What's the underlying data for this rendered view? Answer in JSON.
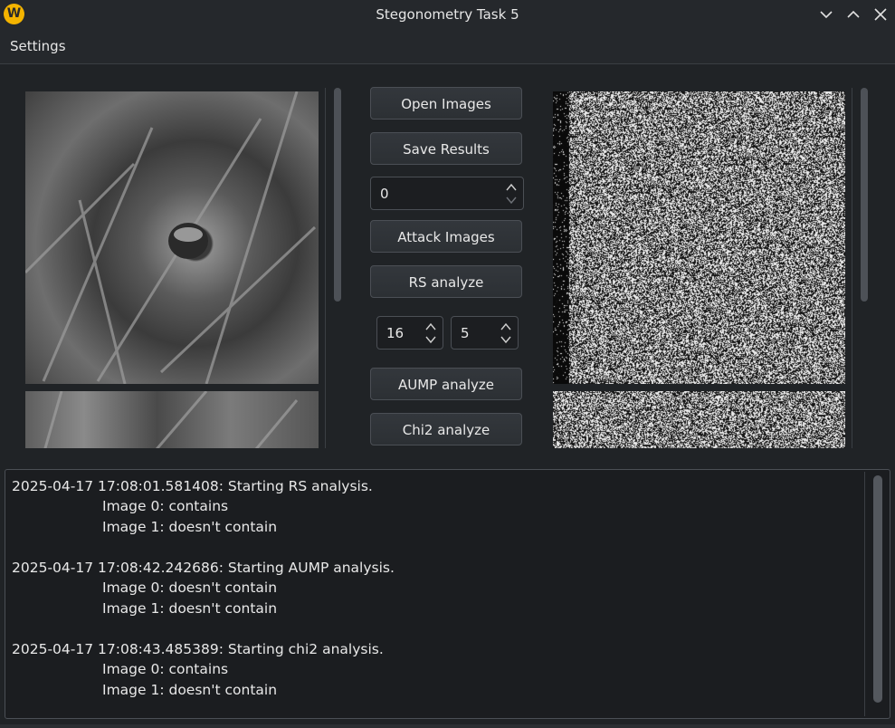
{
  "window": {
    "title": "Stegonometry Task 5",
    "logo_letter": "W"
  },
  "menu": {
    "items": [
      {
        "label": "Settings"
      }
    ]
  },
  "controls": {
    "open_images": "Open Images",
    "save_results": "Save Results",
    "image_index": {
      "value": "0"
    },
    "attack_images": "Attack Images",
    "rs_analyze": "RS analyze",
    "rs_param_1": {
      "value": "16"
    },
    "rs_param_2": {
      "value": "5"
    },
    "aump_analyze": "AUMP analyze",
    "chi2_analyze": "Chi2 analyze"
  },
  "log": {
    "lines": [
      "2025-04-17 17:08:01.581408: Starting RS analysis.",
      "Image 0: contains",
      "Image 1: doesn't contain",
      "2025-04-17 17:08:42.242686: Starting AUMP analysis.",
      "Image 0: doesn't contain",
      "Image 1: doesn't contain",
      "2025-04-17 17:08:43.485389: Starting chi2 analysis.",
      "Image 0: contains",
      "Image 1: doesn't contain"
    ]
  },
  "colors": {
    "background": "#202326",
    "titlebar": "#25282c",
    "button": "#31353a",
    "logo": "#f4b400"
  },
  "icons": [
    "app-logo-icon",
    "minimize-icon",
    "maximize-icon",
    "close-icon",
    "chevron-up-icon",
    "chevron-down-icon"
  ]
}
